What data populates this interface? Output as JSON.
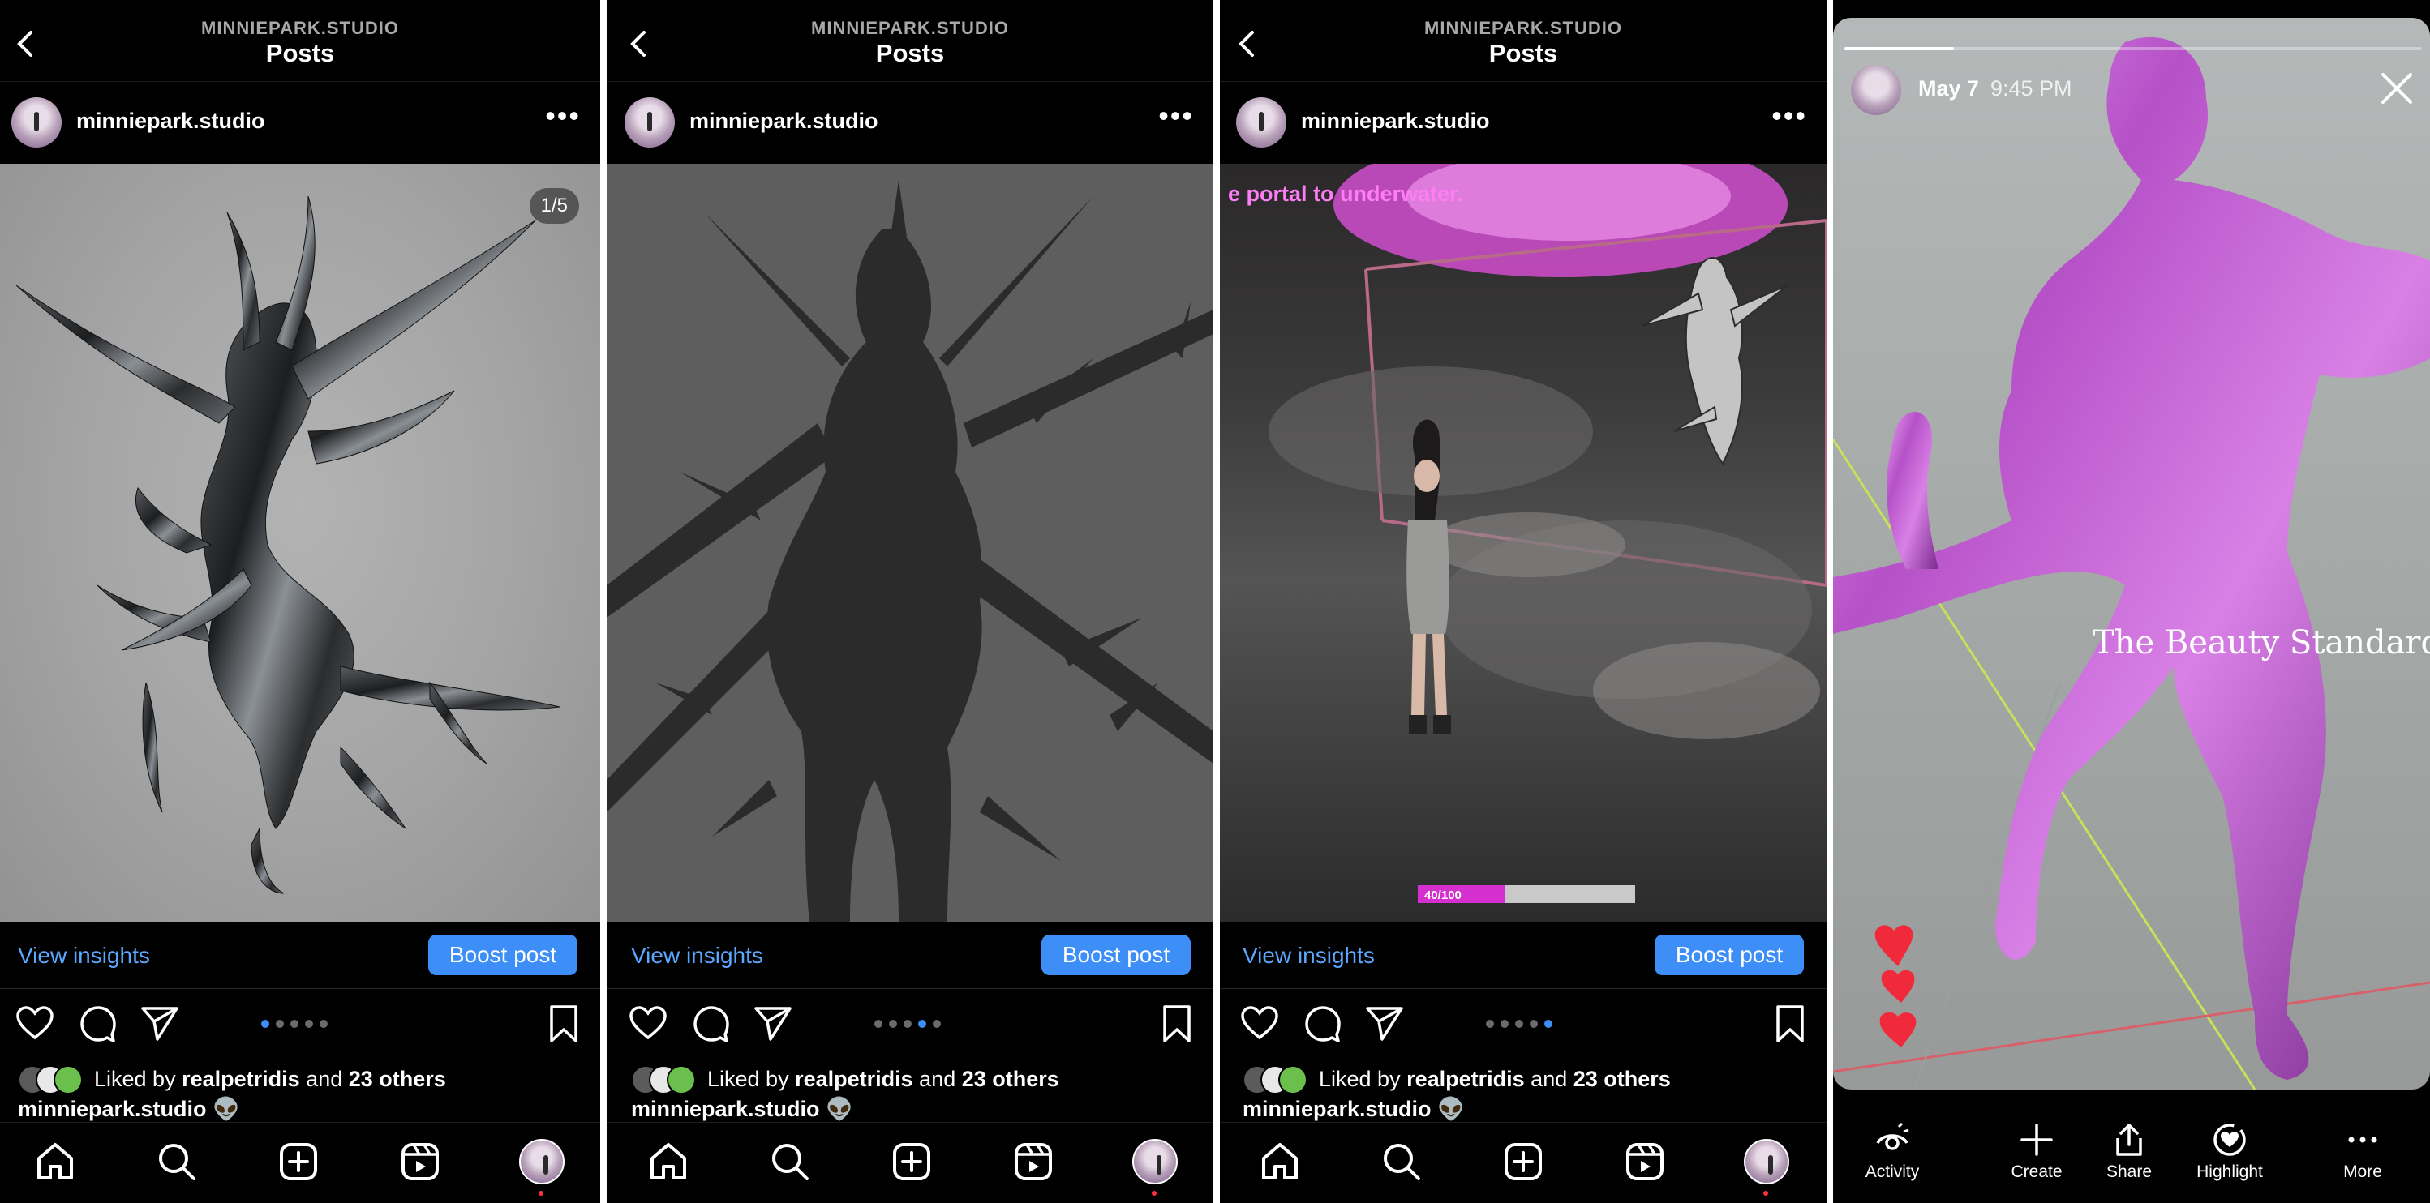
{
  "posts_screen": {
    "account_label": "MINNIEPARK.STUDIO",
    "title": "Posts",
    "username": "minniepark.studio",
    "view_insights_label": "View insights",
    "boost_label": "Boost post",
    "liked_by_prefix": "Liked by",
    "liked_by_user": "realpetridis",
    "liked_by_and": "and",
    "liked_by_others": "23 others",
    "caption_user": "minniepark.studio",
    "caption_emoji": "👽",
    "carousel_total": 5
  },
  "panels": [
    {
      "id": "post-1",
      "counter": "1/5",
      "active_dot": 0,
      "media_overlay_text": ""
    },
    {
      "id": "post-2",
      "counter": "",
      "active_dot": 3,
      "media_overlay_text": ""
    },
    {
      "id": "post-3",
      "counter": "",
      "active_dot": 4,
      "media_overlay_text": "e portal to underwater.",
      "hud_text": "40/100",
      "hud_fraction": 0.4
    }
  ],
  "story": {
    "date": "May 7",
    "time": "9:45 PM",
    "overlay_text": "The Beauty Standard",
    "progress_fraction": 0.19,
    "actions": [
      {
        "label": "Activity",
        "icon": "activity-eye-icon"
      },
      {
        "label": "Create",
        "icon": "plus-icon"
      },
      {
        "label": "Share",
        "icon": "share-icon"
      },
      {
        "label": "Highlight",
        "icon": "highlight-heart-icon"
      },
      {
        "label": "More",
        "icon": "more-dots-icon"
      }
    ]
  },
  "colors": {
    "link_blue": "#5aa8ff",
    "boost_blue": "#3d8ef6",
    "heart_red": "#ff3040",
    "portal_pink": "#e24ad6"
  }
}
